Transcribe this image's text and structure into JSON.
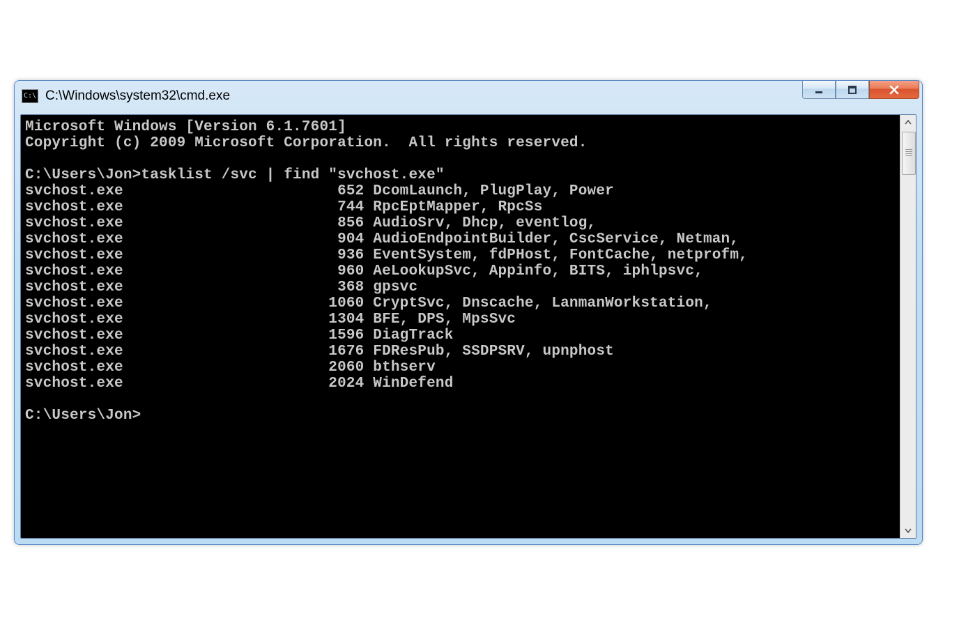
{
  "window": {
    "title": "C:\\Windows\\system32\\cmd.exe"
  },
  "console": {
    "header1": "Microsoft Windows [Version 6.1.7601]",
    "header2": "Copyright (c) 2009 Microsoft Corporation.  All rights reserved.",
    "prompt1_path": "C:\\Users\\Jon>",
    "command": "tasklist /svc | find \"svchost.exe\"",
    "rows": [
      {
        "name": "svchost.exe",
        "pid": "652",
        "services": "DcomLaunch, PlugPlay, Power"
      },
      {
        "name": "svchost.exe",
        "pid": "744",
        "services": "RpcEptMapper, RpcSs"
      },
      {
        "name": "svchost.exe",
        "pid": "856",
        "services": "AudioSrv, Dhcp, eventlog,"
      },
      {
        "name": "svchost.exe",
        "pid": "904",
        "services": "AudioEndpointBuilder, CscService, Netman,"
      },
      {
        "name": "svchost.exe",
        "pid": "936",
        "services": "EventSystem, fdPHost, FontCache, netprofm,"
      },
      {
        "name": "svchost.exe",
        "pid": "960",
        "services": "AeLookupSvc, Appinfo, BITS, iphlpsvc,"
      },
      {
        "name": "svchost.exe",
        "pid": "368",
        "services": "gpsvc"
      },
      {
        "name": "svchost.exe",
        "pid": "1060",
        "services": "CryptSvc, Dnscache, LanmanWorkstation,"
      },
      {
        "name": "svchost.exe",
        "pid": "1304",
        "services": "BFE, DPS, MpsSvc"
      },
      {
        "name": "svchost.exe",
        "pid": "1596",
        "services": "DiagTrack"
      },
      {
        "name": "svchost.exe",
        "pid": "1676",
        "services": "FDResPub, SSDPSRV, upnphost"
      },
      {
        "name": "svchost.exe",
        "pid": "2060",
        "services": "bthserv"
      },
      {
        "name": "svchost.exe",
        "pid": "2024",
        "services": "WinDefend"
      }
    ],
    "prompt2": "C:\\Users\\Jon>"
  },
  "layout": {
    "name_col_width": 25,
    "pid_col_width": 13
  }
}
